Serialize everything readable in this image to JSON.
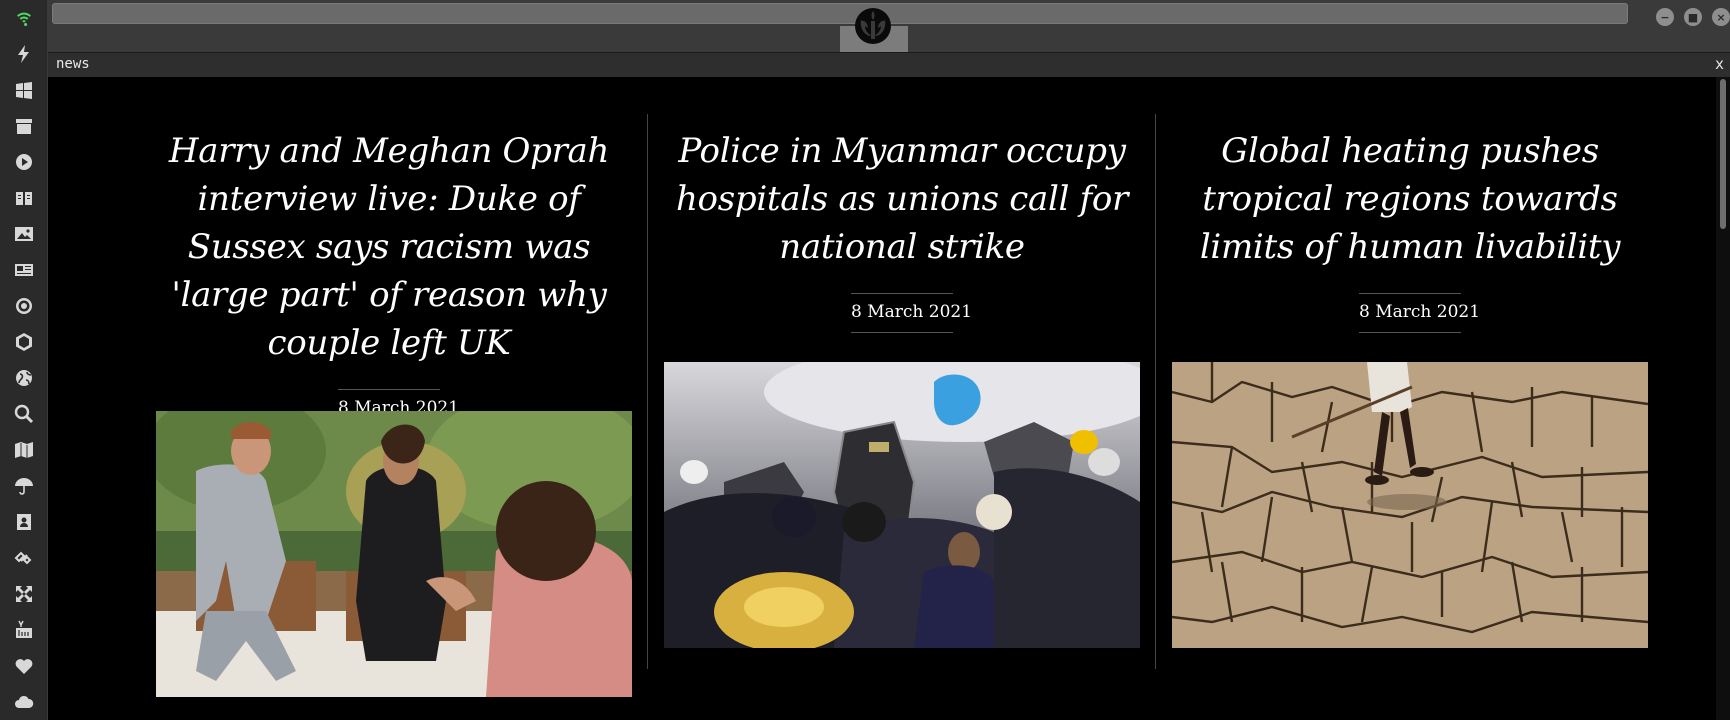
{
  "app": {
    "tab_title": "news",
    "close_label": "x"
  },
  "dock": {
    "icons": [
      "wifi-icon",
      "lightning-icon",
      "windows-icon",
      "archive-icon",
      "play-icon",
      "book-icon",
      "image-icon",
      "newspaper-icon",
      "gear-icon",
      "hexagon-icon",
      "globe-icon",
      "search-icon",
      "map-icon",
      "umbrella-icon",
      "contacts-icon",
      "link-icon",
      "expand-icon",
      "youtube-icon",
      "heart-icon",
      "cloud-icon"
    ]
  },
  "colors": {
    "wifi": "#4cd964",
    "background": "#000000",
    "dock": "#2a2a2a",
    "topbar": "#3a3a3a"
  },
  "articles": [
    {
      "headline": "Harry and Meghan Oprah interview live: Duke of Sussex says racism was 'large part' of reason why couple left UK",
      "date": "8 March 2021"
    },
    {
      "headline": "Police in Myanmar occupy hospitals as unions call for national strike",
      "date": "8 March 2021"
    },
    {
      "headline": "Global heating pushes tropical regions towards limits of human livability",
      "date": "8 March 2021"
    }
  ]
}
